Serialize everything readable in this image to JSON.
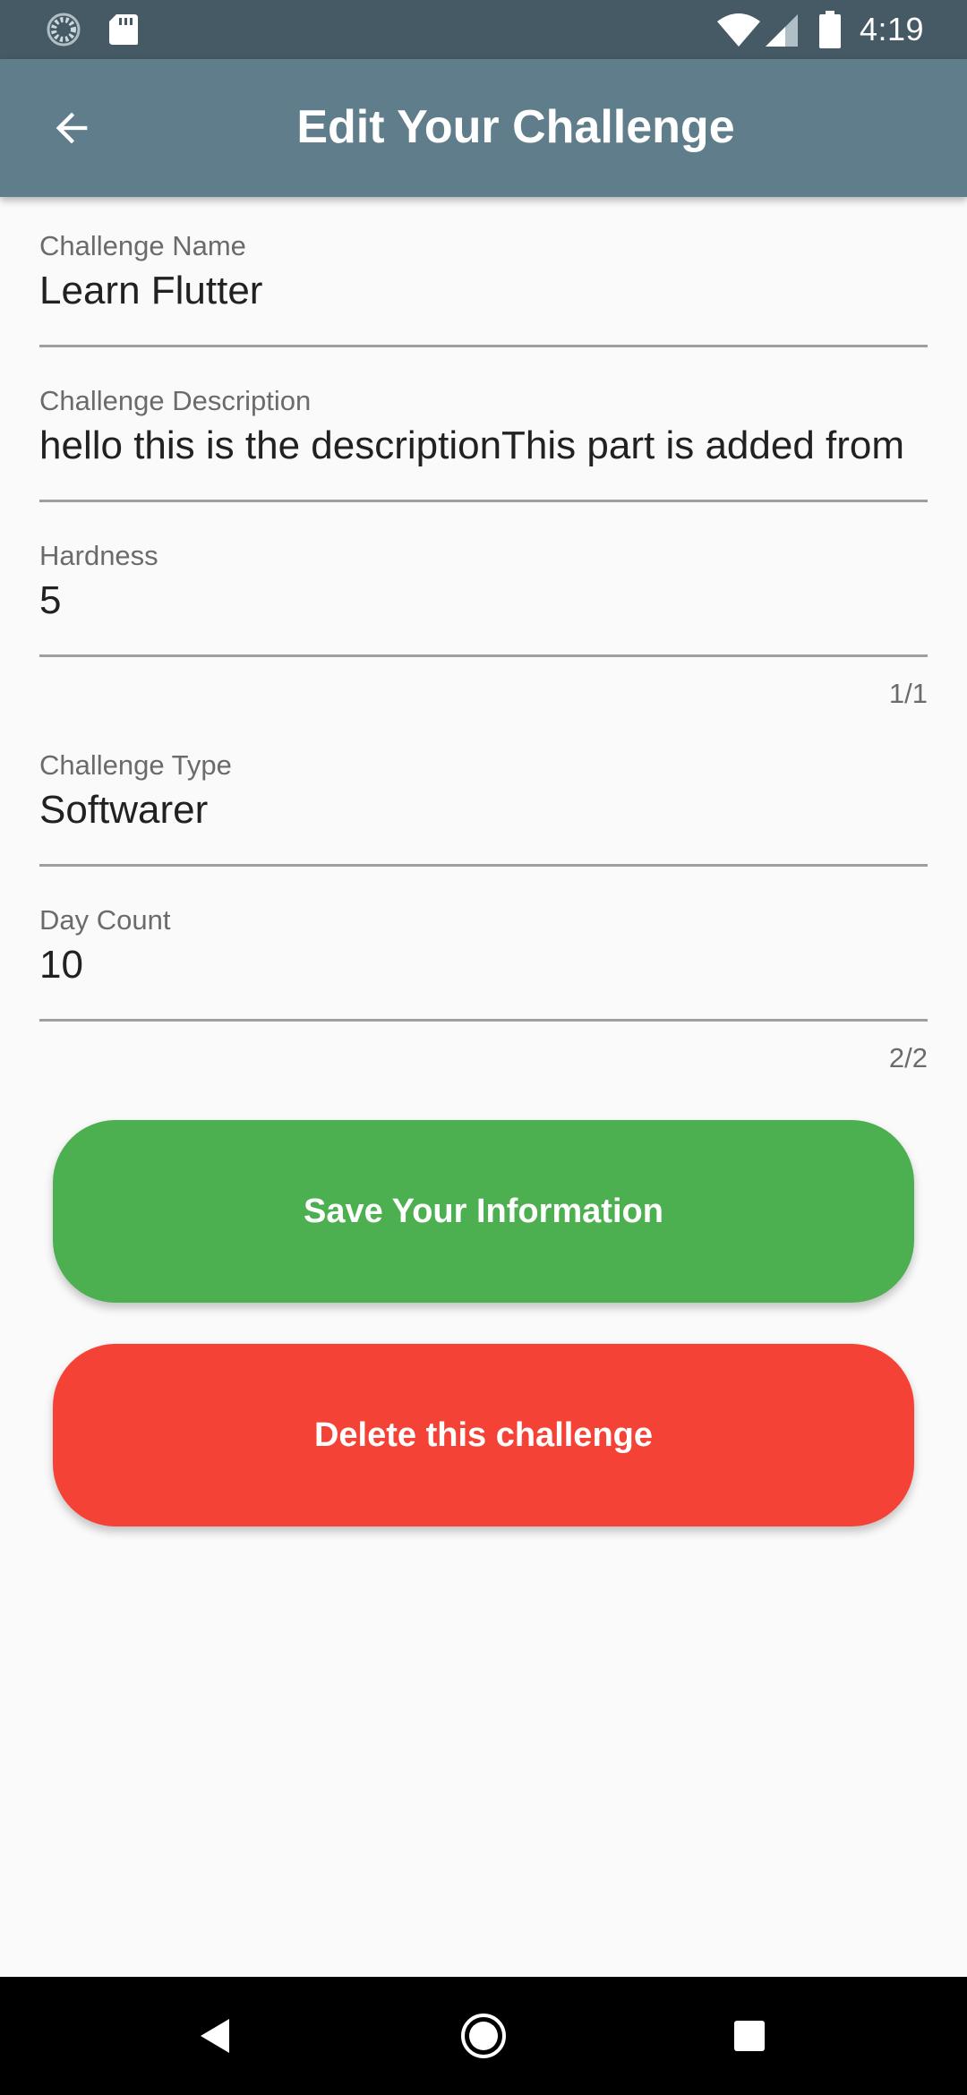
{
  "status_bar": {
    "time": "4:19",
    "icons": [
      "loading-spinner-icon",
      "sd-card-icon",
      "wifi-icon",
      "cell-signal-icon",
      "battery-icon"
    ]
  },
  "app_bar": {
    "title": "Edit Your Challenge",
    "back_icon": "arrow-back-icon",
    "background": "#607d8b"
  },
  "form": {
    "challenge_name": {
      "label": "Challenge Name",
      "value": "Learn Flutter"
    },
    "challenge_description": {
      "label": "Challenge Description",
      "value": "hello this is the descriptionThis part is added from"
    },
    "hardness": {
      "label": "Hardness",
      "value": "5",
      "counter": "1/1"
    },
    "challenge_type": {
      "label": "Challenge Type",
      "value": "Softwarer"
    },
    "day_count": {
      "label": "Day Count",
      "value": "10",
      "counter": "2/2"
    }
  },
  "buttons": {
    "save_label": "Save Your Information",
    "delete_label": "Delete this challenge",
    "save_color": "#4caf50",
    "delete_color": "#f44336"
  },
  "nav_bar": {
    "icons": [
      "nav-back-icon",
      "nav-home-icon",
      "nav-recents-icon"
    ]
  }
}
